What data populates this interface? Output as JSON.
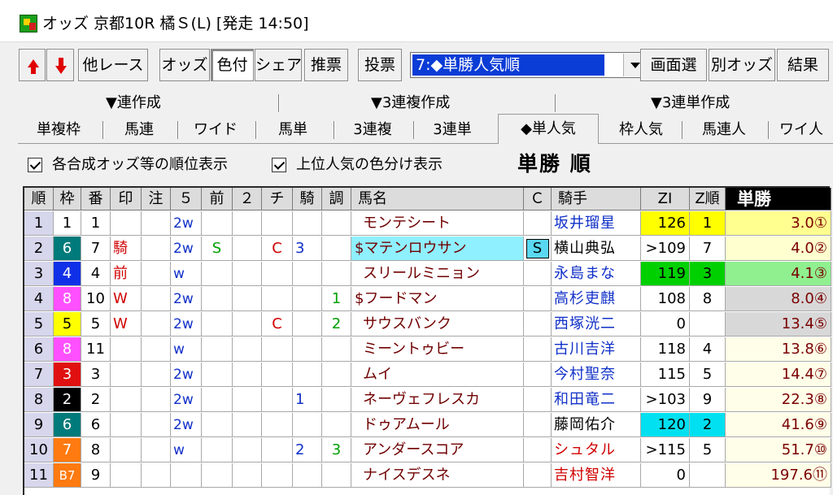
{
  "window": {
    "title": "オッズ 京都10R 橘Ｓ(L) [発走 14:50]"
  },
  "toolbar": {
    "buttons": [
      "他レース",
      "オッズ",
      "色付",
      "シェア",
      "推票",
      "投票"
    ],
    "select_value": "7:◆単勝人気順",
    "right_buttons": [
      "画面選",
      "別オッズ",
      "結果"
    ]
  },
  "tab_groups": [
    "▼連作成",
    "▼3連複作成",
    "▼3連単作成"
  ],
  "tabs": [
    "単複枠",
    "馬連",
    "ワイド",
    "馬単",
    "3連複",
    "3連単",
    "◆単人気",
    "枠人気",
    "馬連人",
    "ワイ人"
  ],
  "options": {
    "rank_display": "各合成オッズ等の順位表示",
    "color_display": "上位人気の色分け表示",
    "heading": "単勝 順"
  },
  "columns": [
    "順",
    "枠",
    "番",
    "印",
    "注",
    "５",
    "前",
    "２",
    "チ",
    "騎",
    "調",
    "馬名",
    "Ｃ",
    "騎手",
    "ZI",
    "Z順",
    "単勝"
  ],
  "colors": {
    "frame": {
      "1": "#ffffff",
      "2": "#000000",
      "3": "#e01010",
      "4": "#1030e8",
      "5": "#ffff00",
      "6": "#007a7a",
      "7": "#ff7a10",
      "8": "#ff50ff"
    },
    "zi_top": "#ffff00",
    "zi_green": "#00d000",
    "zi_cyan": "#00e0f0",
    "odds_top1": "#ffff90",
    "odds_top2": "#ffffd0",
    "odds_top3": "#90f090",
    "odds_gray": "#d8d8d8",
    "odds_plain": "#fffee8"
  },
  "rows": [
    {
      "rank": "1",
      "frame": "1",
      "num": "1",
      "mark": "",
      "note": "",
      "c5": "2w",
      "mae": "",
      "c2": "",
      "chi": "",
      "ki": "",
      "cho": "",
      "name": "モンテシート",
      "c": "",
      "jockey": "坂井瑠星",
      "jockey_color": "blue",
      "zi": "126",
      "zi_bg": "top",
      "zrank": "1",
      "zrank_bg": "top",
      "odds": "3.0①",
      "odds_bg": "top1"
    },
    {
      "rank": "2",
      "frame": "6",
      "num": "7",
      "mark": "騎",
      "note": "",
      "c5": "2w",
      "mae": "S",
      "c2": "",
      "chi": "C",
      "ki": "3",
      "cho": "",
      "name": "$マテンロウサン",
      "name_bg": "cyan",
      "c": "S",
      "jockey": "横山典弘",
      "jockey_color": "black",
      "zi": ">109",
      "zi_bg": "",
      "zrank": "7",
      "zrank_bg": "",
      "odds": "4.0②",
      "odds_bg": "top2"
    },
    {
      "rank": "3",
      "frame": "4",
      "num": "4",
      "mark": "前",
      "note": "",
      "c5": "w",
      "mae": "",
      "c2": "",
      "chi": "",
      "ki": "",
      "cho": "",
      "name": "スリールミニョン",
      "c": "",
      "jockey": "永島まな",
      "jockey_color": "blue",
      "zi": "119",
      "zi_bg": "green",
      "zrank": "3",
      "zrank_bg": "green",
      "odds": "4.1③",
      "odds_bg": "top3"
    },
    {
      "rank": "4",
      "frame": "8",
      "num": "10",
      "mark": "W",
      "note": "",
      "c5": "2w",
      "mae": "",
      "c2": "",
      "chi": "",
      "ki": "",
      "cho": "1",
      "name": "$フードマン",
      "c": "",
      "jockey": "高杉吏麒",
      "jockey_color": "blue",
      "zi": "108",
      "zi_bg": "",
      "zrank": "8",
      "zrank_bg": "",
      "odds": "8.0④",
      "odds_bg": "gray"
    },
    {
      "rank": "5",
      "frame": "5",
      "num": "5",
      "mark": "W",
      "note": "",
      "c5": "2w",
      "mae": "",
      "c2": "",
      "chi": "C",
      "ki": "",
      "cho": "2",
      "name": "サウスバンク",
      "c": "",
      "jockey": "西塚洸二",
      "jockey_color": "blue",
      "zi": "0",
      "zi_bg": "",
      "zrank": "",
      "zrank_bg": "",
      "odds": "13.4⑤",
      "odds_bg": "gray"
    },
    {
      "rank": "6",
      "frame": "8",
      "num": "11",
      "mark": "",
      "note": "",
      "c5": "w",
      "mae": "",
      "c2": "",
      "chi": "",
      "ki": "",
      "cho": "",
      "name": "ミーントゥビー",
      "c": "",
      "jockey": "古川吉洋",
      "jockey_color": "blue",
      "zi": "118",
      "zi_bg": "",
      "zrank": "4",
      "zrank_bg": "",
      "odds": "13.8⑥",
      "odds_bg": "plain"
    },
    {
      "rank": "7",
      "frame": "3",
      "num": "3",
      "mark": "",
      "note": "",
      "c5": "2w",
      "mae": "",
      "c2": "",
      "chi": "",
      "ki": "",
      "cho": "",
      "name": "ムイ",
      "c": "",
      "jockey": "今村聖奈",
      "jockey_color": "blue",
      "zi": "115",
      "zi_bg": "",
      "zrank": "5",
      "zrank_bg": "",
      "odds": "14.4⑦",
      "odds_bg": "plain"
    },
    {
      "rank": "8",
      "frame": "2",
      "num": "2",
      "mark": "",
      "note": "",
      "c5": "2w",
      "mae": "",
      "c2": "",
      "chi": "",
      "ki": "1",
      "cho": "",
      "name": "ネーヴェフレスカ",
      "c": "",
      "jockey": "和田竜二",
      "jockey_color": "blue",
      "zi": ">103",
      "zi_bg": "",
      "zrank": "9",
      "zrank_bg": "",
      "odds": "22.3⑧",
      "odds_bg": "plain"
    },
    {
      "rank": "9",
      "frame": "6",
      "num": "6",
      "mark": "",
      "note": "",
      "c5": "2w",
      "mae": "",
      "c2": "",
      "chi": "",
      "ki": "",
      "cho": "",
      "name": "ドゥアムール",
      "c": "",
      "jockey": "藤岡佑介",
      "jockey_color": "black",
      "zi": "120",
      "zi_bg": "cyan",
      "zrank": "2",
      "zrank_bg": "cyan",
      "odds": "41.6⑨",
      "odds_bg": "plain"
    },
    {
      "rank": "10",
      "frame": "7",
      "num": "8",
      "mark": "",
      "note": "",
      "c5": "w",
      "mae": "",
      "c2": "",
      "chi": "",
      "ki": "2",
      "cho": "3",
      "name": "アンダースコア",
      "c": "",
      "jockey": "シュタル",
      "jockey_color": "red",
      "zi": ">115",
      "zi_bg": "",
      "zrank": "5",
      "zrank_bg": "",
      "odds": "51.7⑩",
      "odds_bg": "plain"
    },
    {
      "rank": "11",
      "frame": "7",
      "frame_label": "B7",
      "num": "9",
      "mark": "",
      "note": "",
      "c5": "",
      "mae": "",
      "c2": "",
      "chi": "",
      "ki": "",
      "cho": "",
      "name": "ナイスデスネ",
      "c": "",
      "jockey": "吉村智洋",
      "jockey_color": "red",
      "zi": "0",
      "zi_bg": "",
      "zrank": "",
      "zrank_bg": "",
      "odds": "197.6⑪",
      "odds_bg": "plain"
    }
  ]
}
